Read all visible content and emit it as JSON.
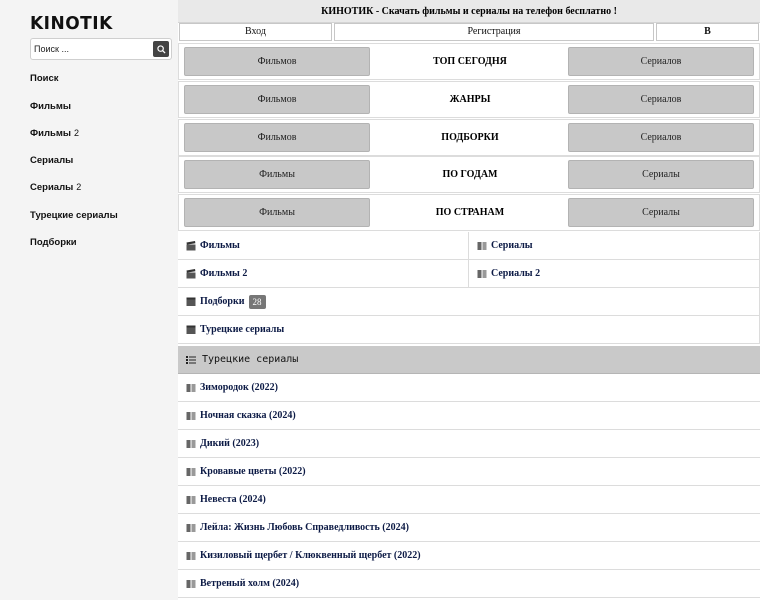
{
  "sidebar": {
    "logo": "KINOTIK",
    "search_placeholder": "Поиск ...",
    "items": [
      {
        "label": "Поиск",
        "sup": ""
      },
      {
        "label": "Фильмы",
        "sup": ""
      },
      {
        "label": "Фильмы",
        "sup": "2"
      },
      {
        "label": "Сериалы",
        "sup": ""
      },
      {
        "label": "Сериалы",
        "sup": "2"
      },
      {
        "label": "Турецкие сериалы",
        "sup": ""
      },
      {
        "label": "Подборки",
        "sup": ""
      }
    ]
  },
  "header": {
    "title": "КИНОТИК - Скачать фильмы и сериалы на телефон бесплатно !",
    "login": "Вход",
    "register": "Регистрация",
    "vk": "В"
  },
  "menu_rows": [
    {
      "left": "Фильмов",
      "center": "ТОП СЕГОДНЯ",
      "right": "Сериалов"
    },
    {
      "left": "Фильмов",
      "center": "ЖАНРЫ",
      "right": "Сериалов"
    },
    {
      "left": "Фильмов",
      "center": "ПОДБОРКИ",
      "right": "Сериалов"
    },
    {
      "left": "Фильмы",
      "center": "ПО ГОДАМ",
      "right": "Сериалы"
    },
    {
      "left": "Фильмы",
      "center": "ПО СТРАНАМ",
      "right": "Сериалы"
    }
  ],
  "categories": {
    "films": "Фильмы",
    "serials": "Сериалы",
    "films2": "Фильмы 2",
    "serials2": "Сериалы 2",
    "collections": "Подборки",
    "collections_count": "28",
    "turkish": "Турецкие сериалы"
  },
  "section": {
    "title": "Турецкие сериалы",
    "items": [
      "Зимородок (2022)",
      "Ночная сказка (2024)",
      "Дикий (2023)",
      "Кровавые цветы (2022)",
      "Невеста (2024)",
      "Лейла: Жизнь Любовь Справедливость (2024)",
      "Кизиловый щербет / Клюквенный щербет (2022)",
      "Ветреный холм (2024)"
    ]
  }
}
